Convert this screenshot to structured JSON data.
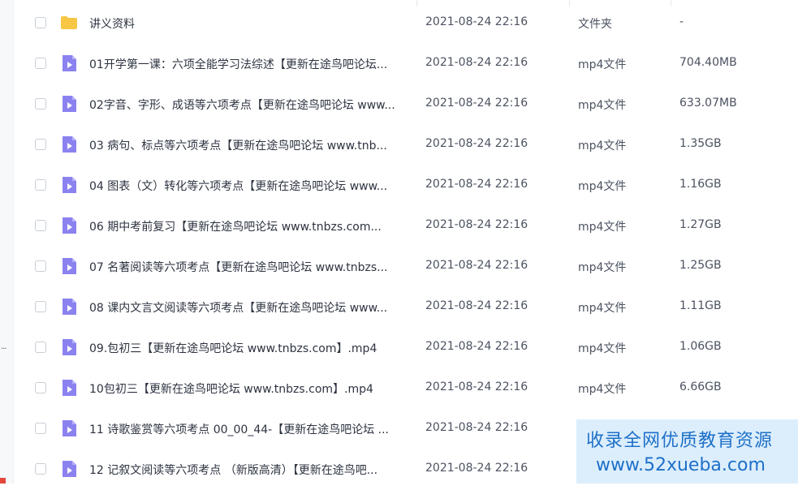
{
  "colors": {
    "folder": "#f7c645",
    "video": "#8b82f0",
    "watermark_text": "#1e70c8"
  },
  "files": [
    {
      "icon": "folder-icon",
      "name": "讲义资料",
      "date": "2021-08-24 22:16",
      "type": "文件夹",
      "size": "-"
    },
    {
      "icon": "video-file-icon",
      "name": "01开学第一课：六项全能学习法综述【更新在途鸟吧论坛...",
      "date": "2021-08-24 22:16",
      "type": "mp4文件",
      "size": "704.40MB"
    },
    {
      "icon": "video-file-icon",
      "name": "02字音、字形、成语等六项考点【更新在途鸟吧论坛 www...",
      "date": "2021-08-24 22:16",
      "type": "mp4文件",
      "size": "633.07MB"
    },
    {
      "icon": "video-file-icon",
      "name": "03 病句、标点等六项考点【更新在途鸟吧论坛 www.tnb...",
      "date": "2021-08-24 22:16",
      "type": "mp4文件",
      "size": "1.35GB"
    },
    {
      "icon": "video-file-icon",
      "name": "04 图表（文）转化等六项考点【更新在途鸟吧论坛 www...",
      "date": "2021-08-24 22:16",
      "type": "mp4文件",
      "size": "1.16GB"
    },
    {
      "icon": "video-file-icon",
      "name": "06 期中考前复习【更新在途鸟吧论坛 www.tnbzs.com...",
      "date": "2021-08-24 22:16",
      "type": "mp4文件",
      "size": "1.27GB"
    },
    {
      "icon": "video-file-icon",
      "name": "07 名著阅读等六项考点【更新在途鸟吧论坛 www.tnbzs...",
      "date": "2021-08-24 22:16",
      "type": "mp4文件",
      "size": "1.25GB"
    },
    {
      "icon": "video-file-icon",
      "name": "08 课内文言文阅读等六项考点【更新在途鸟吧论坛 www...",
      "date": "2021-08-24 22:16",
      "type": "mp4文件",
      "size": "1.11GB"
    },
    {
      "icon": "video-file-icon",
      "name": "09.包初三【更新在途鸟吧论坛 www.tnbzs.com】.mp4",
      "date": "2021-08-24 22:16",
      "type": "mp4文件",
      "size": "1.06GB"
    },
    {
      "icon": "video-file-icon",
      "name": "10包初三【更新在途鸟吧论坛 www.tnbzs.com】.mp4",
      "date": "2021-08-24 22:16",
      "type": "mp4文件",
      "size": "6.66GB"
    },
    {
      "icon": "video-file-icon",
      "name": "11 诗歌鉴赏等六项考点 00_00_44-【更新在途鸟吧论坛 ...",
      "date": "2021-08-24 22:16",
      "type": "",
      "size": ""
    },
    {
      "icon": "video-file-icon",
      "name": "12 记叙文阅读等六项考点 （新版高清）【更新在途鸟吧...",
      "date": "2021-08-24 22:16",
      "type": "",
      "size": ""
    }
  ],
  "sidebar": {
    "overflow_mark": "..."
  },
  "watermark": {
    "line1": "收录全网优质教育资源",
    "line2": "www.52xueba.com"
  }
}
